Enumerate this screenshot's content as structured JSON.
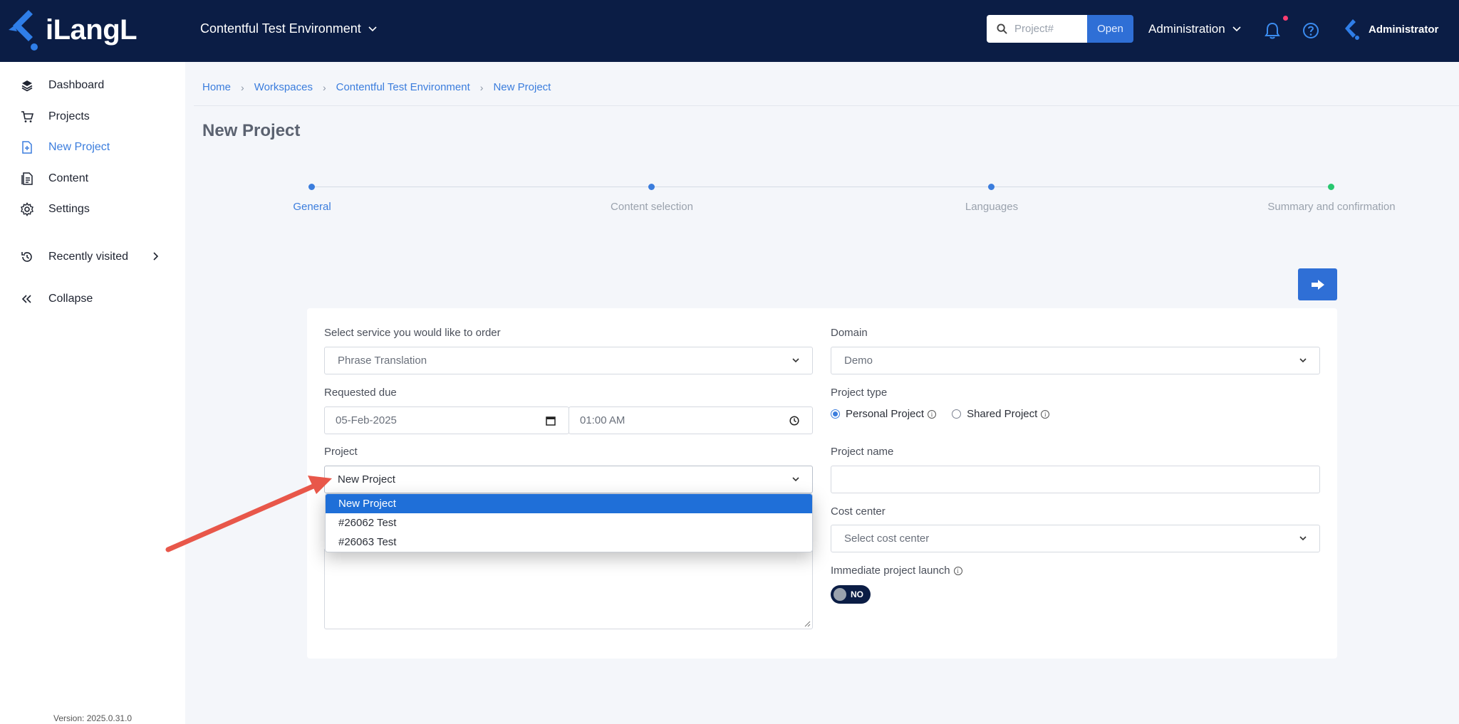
{
  "app": {
    "logo_text": "iLangL",
    "workspace": "Contentful Test Environment",
    "search": {
      "placeholder": "Project#",
      "open_label": "Open"
    },
    "admin_menu": "Administration",
    "user_name": "Administrator"
  },
  "sidebar": {
    "items": [
      {
        "label": "Dashboard",
        "icon": "layers-icon"
      },
      {
        "label": "Projects",
        "icon": "cart-icon"
      },
      {
        "label": "New Project",
        "icon": "file-plus-icon",
        "active": true
      },
      {
        "label": "Content",
        "icon": "document-icon"
      },
      {
        "label": "Settings",
        "icon": "gear-icon"
      }
    ],
    "recently_visited": "Recently visited",
    "collapse": "Collapse",
    "version": "Version: 2025.0.31.0"
  },
  "breadcrumb": [
    "Home",
    "Workspaces",
    "Contentful Test Environment",
    "New Project"
  ],
  "page_title": "New Project",
  "stepper": {
    "steps": [
      {
        "label": "General",
        "active": true
      },
      {
        "label": "Content selection",
        "active": false
      },
      {
        "label": "Languages",
        "active": false
      },
      {
        "label": "Summary and confirmation",
        "active": false
      }
    ]
  },
  "form": {
    "service_label": "Select service you would like to order",
    "service_value": "Phrase Translation",
    "domain_label": "Domain",
    "domain_value": "Demo",
    "due_label": "Requested due",
    "due_date": "05-Feb-2025",
    "due_time": "01:00 AM",
    "project_type_label": "Project type",
    "project_type_options": [
      "Personal Project",
      "Shared Project"
    ],
    "project_type_selected": "Personal Project",
    "project_label": "Project",
    "project_value": "New Project",
    "project_name_label": "Project name",
    "project_name_value": "",
    "cost_center_label": "Cost center",
    "cost_center_placeholder": "Select cost center",
    "immediate_launch_label": "Immediate project launch",
    "immediate_launch_value": "NO"
  },
  "project_dropdown": {
    "options": [
      "New Project",
      "#26062 Test",
      "#26063 Test"
    ],
    "selected": "New Project"
  },
  "colors": {
    "topbar": "#0b1d45",
    "accent": "#3b7ddd",
    "annotation_arrow": "#e8574a"
  }
}
